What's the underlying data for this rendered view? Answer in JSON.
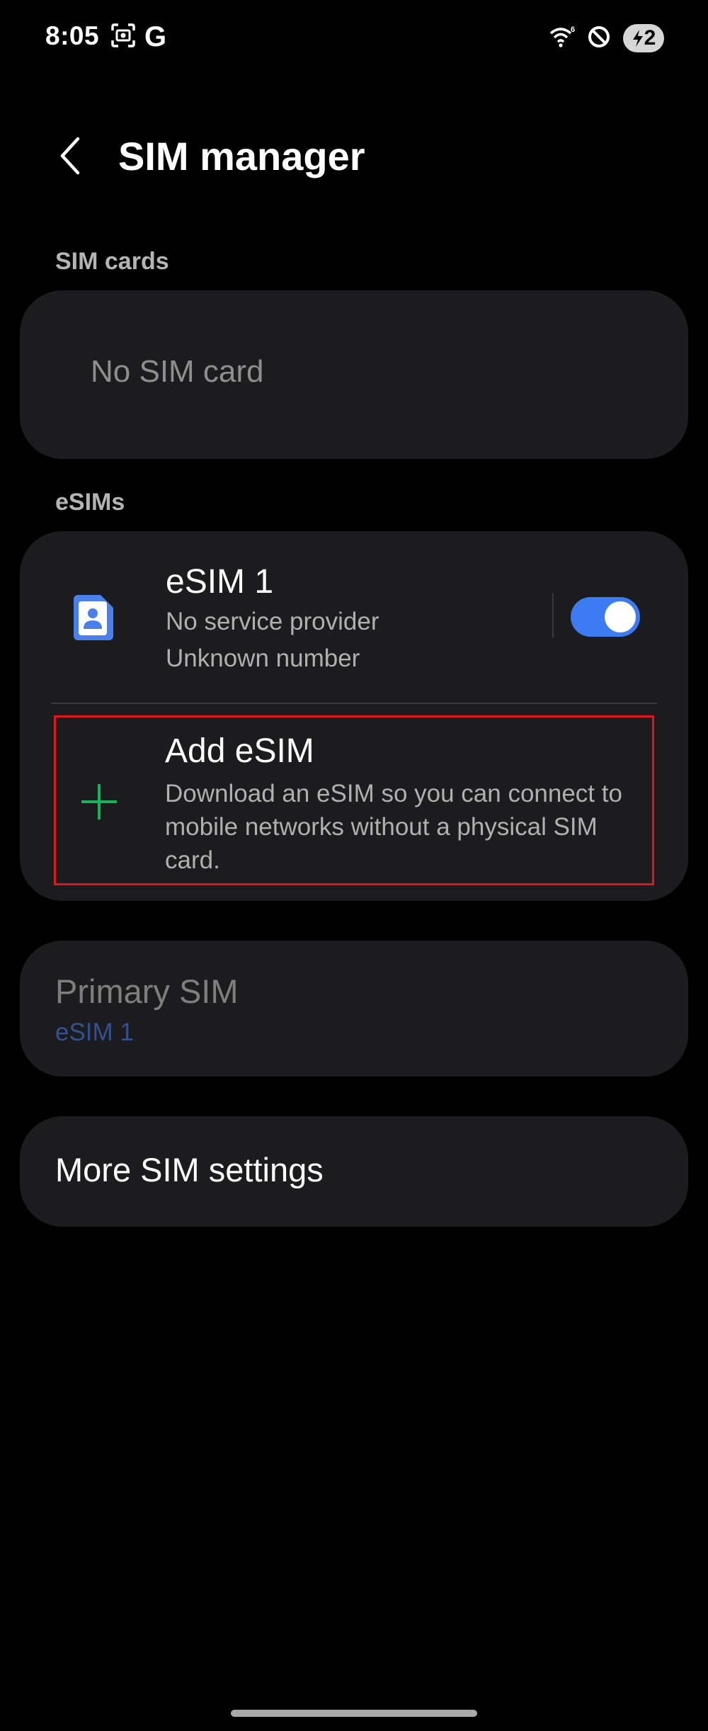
{
  "status_bar": {
    "time": "8:05",
    "g_label": "G",
    "battery_level": "2",
    "icons": [
      "screenshot-icon",
      "google-icon",
      "wifi-icon",
      "do-not-disturb-icon",
      "battery-charging-icon"
    ]
  },
  "header": {
    "title": "SIM manager",
    "back_icon": "chevron-left-icon"
  },
  "sim_cards": {
    "section_label": "SIM cards",
    "empty_text": "No SIM card"
  },
  "esims": {
    "section_label": "eSIMs",
    "items": [
      {
        "title": "eSIM 1",
        "provider": "No service provider",
        "number": "Unknown number",
        "enabled": true,
        "icon": "sim-contact-icon"
      }
    ],
    "add": {
      "title": "Add eSIM",
      "description": "Download an eSIM so you can connect to mobile networks without a physical SIM card.",
      "icon": "plus-icon"
    }
  },
  "primary_sim": {
    "title": "Primary SIM",
    "value": "eSIM 1"
  },
  "more_settings": {
    "title": "More SIM settings"
  },
  "colors": {
    "background": "#000000",
    "card": "#1c1c1e",
    "accent_blue": "#3d7bf2",
    "plus_green": "#17b35a",
    "highlight_red": "#e3141b"
  }
}
